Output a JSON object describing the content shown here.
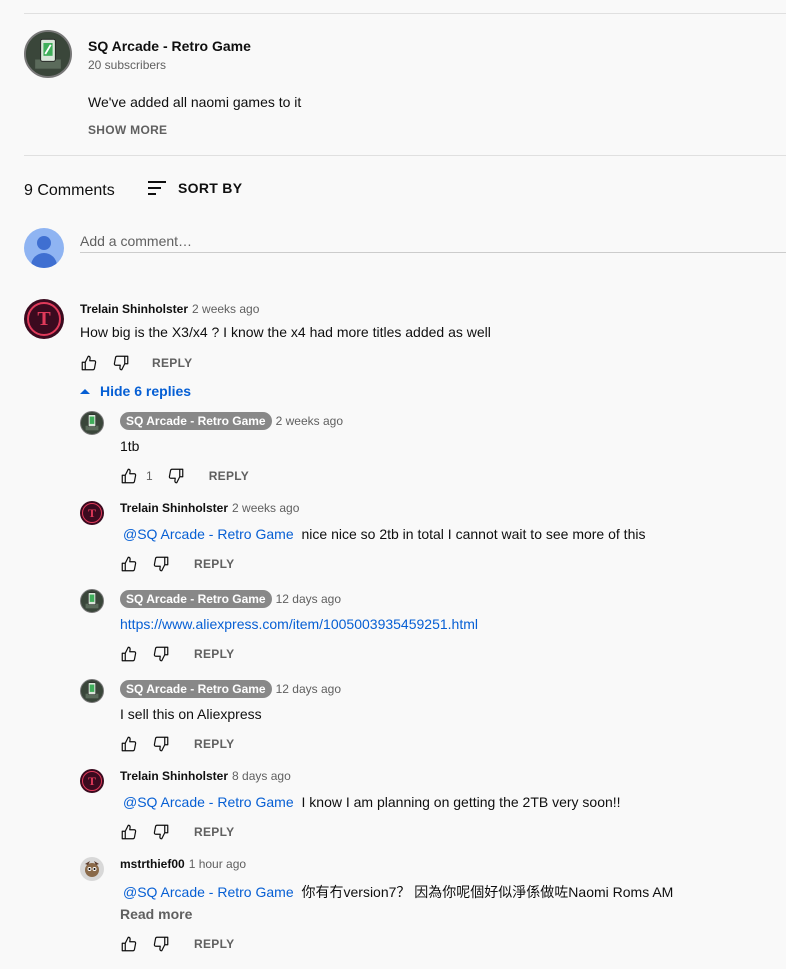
{
  "owner": {
    "name": "SQ Arcade - Retro Game",
    "subscribers": "20 subscribers",
    "description": "We've added all naomi games to it",
    "show_more": "SHOW MORE"
  },
  "comments_header": {
    "count": "9 Comments",
    "sort_label": "SORT BY"
  },
  "add_comment": {
    "placeholder": "Add a comment…"
  },
  "icons": {
    "like": "thumb-up-icon",
    "dislike": "thumb-down-icon",
    "sort": "sort-icon",
    "collapse": "chevron-up-icon"
  },
  "colors": {
    "link": "#065fd4",
    "muted": "#606060",
    "accent_red": "#e03a5a"
  },
  "top_comment": {
    "author": "Trelain Shinholster",
    "time": "2 weeks ago",
    "text": "How big is the X3/x4 ? I know the x4 had more titles added as well",
    "reply_label": "REPLY",
    "hide_replies": "Hide 6 replies"
  },
  "replies": [
    {
      "author": "SQ Arcade - Retro Game",
      "time": "2 weeks ago",
      "mention": "",
      "text": "1tb",
      "likes": "1",
      "reply_label": "REPLY"
    },
    {
      "author": "Trelain Shinholster",
      "time": "2 weeks ago",
      "mention": "@SQ Arcade - Retro Game",
      "text": "nice nice so 2tb in total I cannot wait to see more of this",
      "likes": "",
      "reply_label": "REPLY"
    },
    {
      "author": "SQ Arcade - Retro Game",
      "time": "12 days ago",
      "mention": "",
      "text": "https://www.aliexpress.com/item/1005003935459251.html",
      "likes": "",
      "reply_label": "REPLY"
    },
    {
      "author": "SQ Arcade - Retro Game",
      "time": "12 days ago",
      "mention": "",
      "text": "I sell this on Aliexpress",
      "likes": "",
      "reply_label": "REPLY"
    },
    {
      "author": "Trelain Shinholster",
      "time": "8 days ago",
      "mention": "@SQ Arcade - Retro Game",
      "text": "I know I am planning on getting the 2TB very soon!!",
      "likes": "",
      "reply_label": "REPLY"
    },
    {
      "author": "mstrthief00",
      "time": "1 hour ago",
      "mention": "@SQ Arcade - Retro Game",
      "text": "你有冇version7？ 因為你呢個好似淨係做咗Naomi Roms AM",
      "read_more": "Read more",
      "likes": "",
      "reply_label": "REPLY"
    }
  ]
}
